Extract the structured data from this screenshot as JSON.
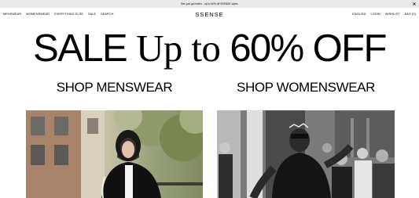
{
  "banner": {
    "text": "See just got better - up to 60% off SSENSE styles",
    "close_icon": "close-icon"
  },
  "nav": {
    "left": [
      "MENSWEAR",
      "WOMENSWEAR",
      "EVERYTHING ELSE",
      "SALE",
      "SEARCH"
    ],
    "right": [
      "ENGLISH",
      "LOGIN",
      "WISHLIST",
      "BAG (0)"
    ]
  },
  "logo": "SSENSE",
  "hero": {
    "part1": "SALE",
    "part2": "Up to",
    "part3": "60% OFF"
  },
  "cta": {
    "men": "SHOP MENSWEAR",
    "women": "SHOP WOMENSWEAR"
  },
  "colors": {
    "banner_bg": "#e9e9e9",
    "text": "#000000",
    "background": "#ffffff"
  }
}
